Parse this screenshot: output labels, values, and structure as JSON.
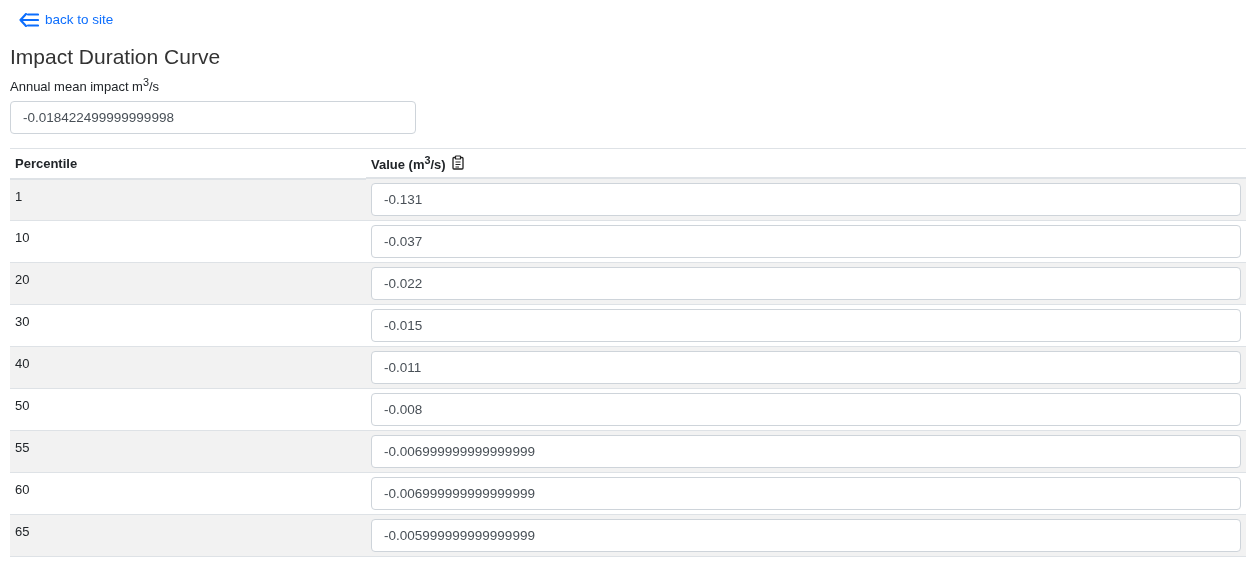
{
  "back_link": {
    "label": "back to site"
  },
  "title": "Impact Duration Curve",
  "annual_mean": {
    "label": "Annual mean impact m$^{3}$/s",
    "value": "-0.018422499999999998"
  },
  "table": {
    "columns": [
      "Percentile",
      "Value (m$^{3}$/s)"
    ],
    "rows": [
      {
        "percentile": "1",
        "value": "-0.131"
      },
      {
        "percentile": "10",
        "value": "-0.037"
      },
      {
        "percentile": "20",
        "value": "-0.022"
      },
      {
        "percentile": "30",
        "value": "-0.015"
      },
      {
        "percentile": "40",
        "value": "-0.011"
      },
      {
        "percentile": "50",
        "value": "-0.008"
      },
      {
        "percentile": "55",
        "value": "-0.006999999999999999"
      },
      {
        "percentile": "60",
        "value": "-0.006999999999999999"
      },
      {
        "percentile": "65",
        "value": "-0.005999999999999999"
      }
    ]
  }
}
